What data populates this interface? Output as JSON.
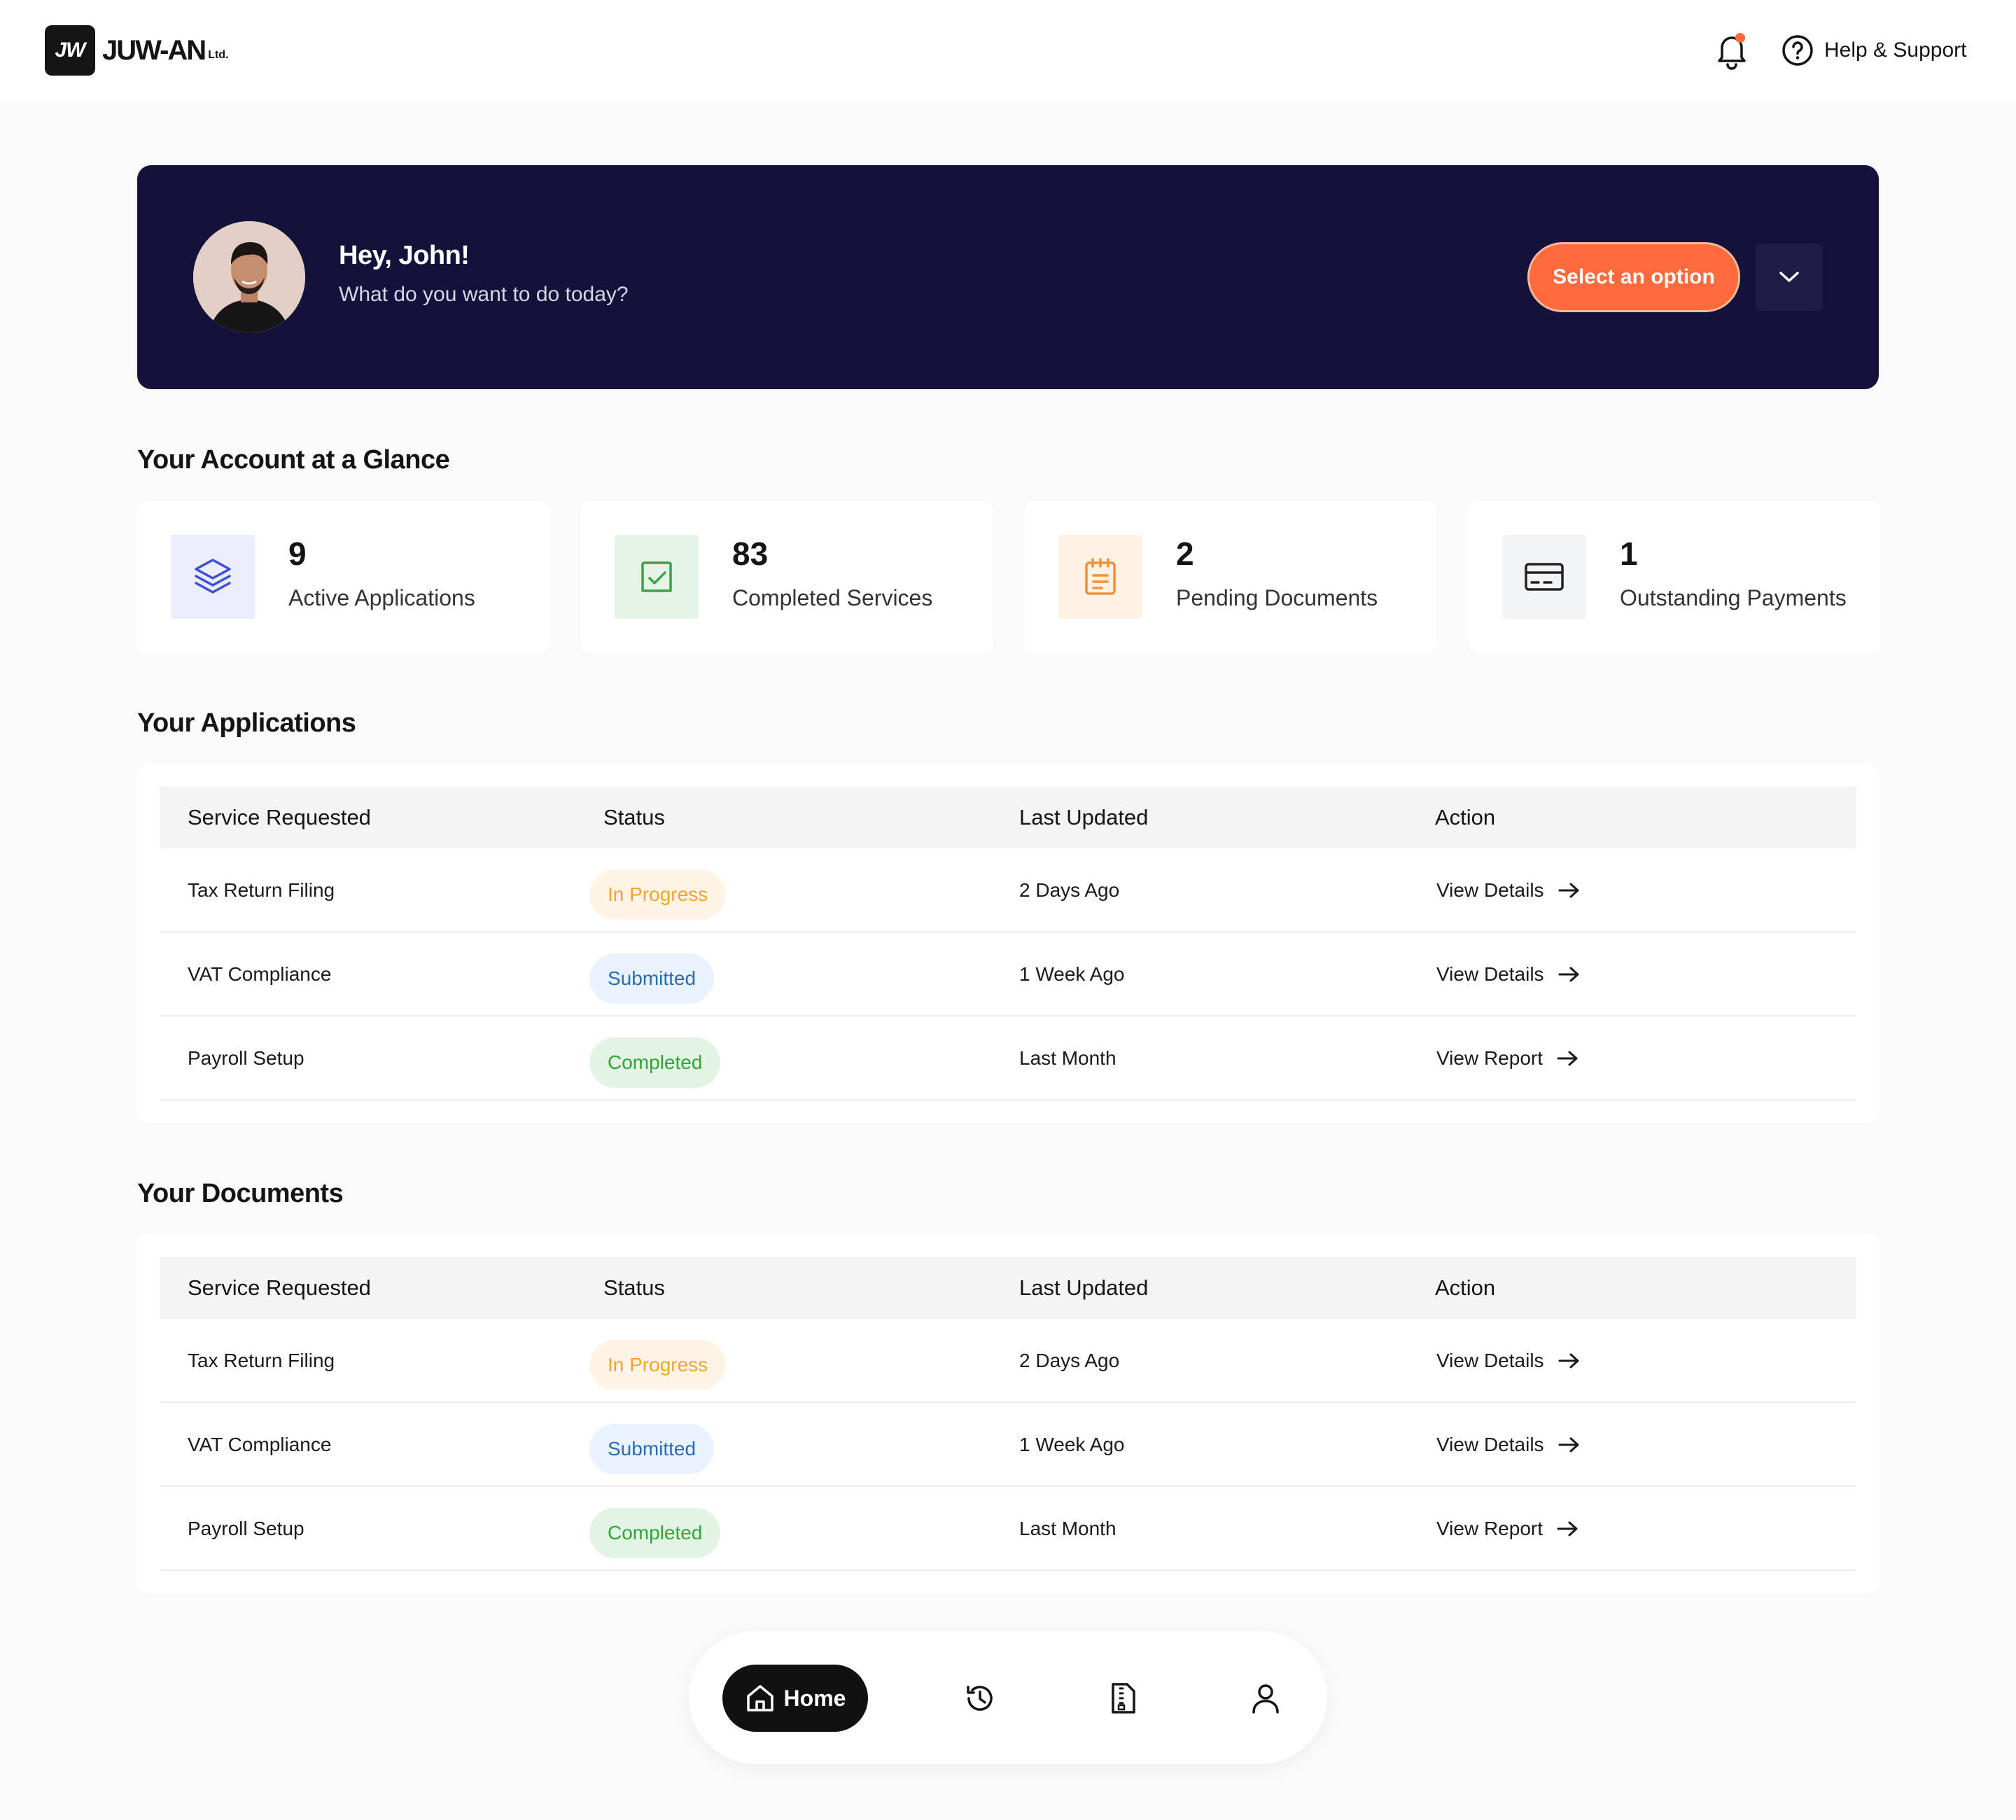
{
  "header": {
    "logo_mark": "JW",
    "logo_text": "JUW-AN",
    "logo_suffix": "Ltd.",
    "help_label": "Help & Support"
  },
  "hero": {
    "greeting": "Hey, John!",
    "subtitle": "What do you want to do today?",
    "select_label": "Select an option"
  },
  "glance": {
    "title": "Your Account at a Glance",
    "cards": [
      {
        "value": "9",
        "label": "Active Applications",
        "icon": "layers-icon",
        "tint": "#ECEEFD",
        "color": "#3D4FD8"
      },
      {
        "value": "83",
        "label": "Completed Services",
        "icon": "checkbox-icon",
        "tint": "#E6F4E7",
        "color": "#3AA346"
      },
      {
        "value": "2",
        "label": "Pending Documents",
        "icon": "notepad-icon",
        "tint": "#FFF2E4",
        "color": "#F2913B"
      },
      {
        "value": "1",
        "label": "Outstanding Payments",
        "icon": "card-icon",
        "tint": "#F3F4F6",
        "color": "#222222"
      }
    ]
  },
  "applications": {
    "title": "Your Applications",
    "columns": [
      "Service Requested",
      "Status",
      "Last Updated",
      "Action"
    ],
    "rows": [
      {
        "service": "Tax Return Filing",
        "status": "In Progress",
        "updated": "2 Days Ago",
        "action": "View Details"
      },
      {
        "service": "VAT Compliance",
        "status": "Submitted",
        "updated": "1 Week Ago",
        "action": "View Details"
      },
      {
        "service": "Payroll Setup",
        "status": "Completed",
        "updated": "Last Month",
        "action": "View Report"
      }
    ]
  },
  "documents": {
    "title": "Your Documents",
    "columns": [
      "Service Requested",
      "Status",
      "Last Updated",
      "Action"
    ],
    "rows": [
      {
        "service": "Tax Return Filing",
        "status": "In Progress",
        "updated": "2 Days Ago",
        "action": "View Details"
      },
      {
        "service": "VAT Compliance",
        "status": "Submitted",
        "updated": "1 Week Ago",
        "action": "View Details"
      },
      {
        "service": "Payroll Setup",
        "status": "Completed",
        "updated": "Last Month",
        "action": "View Report"
      }
    ]
  },
  "bottom_nav": {
    "home_label": "Home",
    "items": [
      "home-icon",
      "history-icon",
      "document-icon",
      "profile-icon"
    ]
  },
  "colors": {
    "hero_bg": "#13123A",
    "accent": "#FF6A3D",
    "notification_dot": "#FF6A3D"
  }
}
